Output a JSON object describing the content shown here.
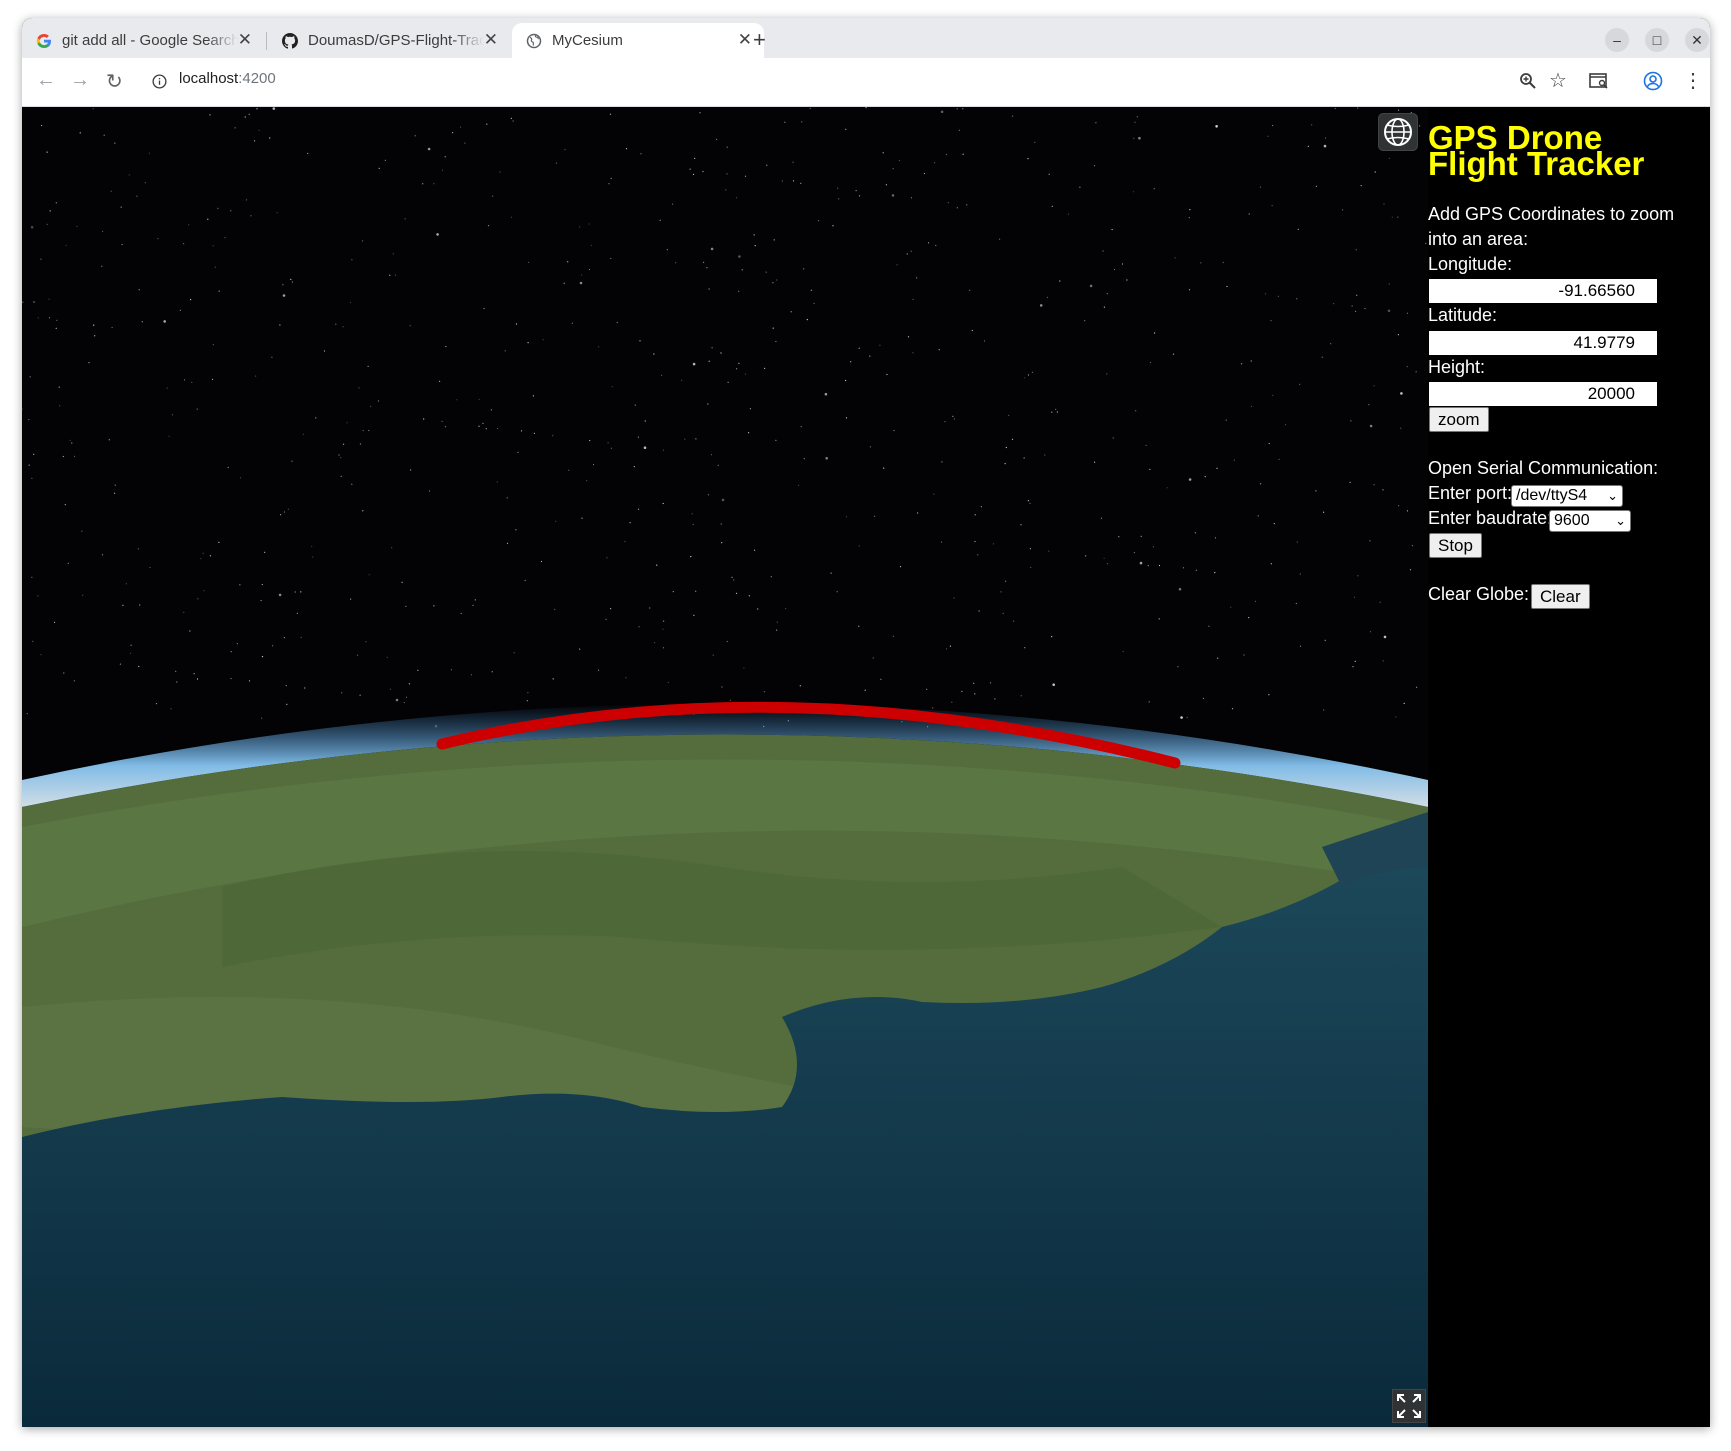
{
  "browser": {
    "tabs": [
      {
        "title": "git add all - Google Search",
        "favicon": "google-icon",
        "active": false
      },
      {
        "title": "DoumasD/GPS-Flight-Tracker",
        "favicon": "github-icon",
        "active": false
      },
      {
        "title": "MyCesium",
        "favicon": "globe-icon",
        "active": true
      }
    ],
    "new_tab_glyph": "+",
    "url_host": "localhost",
    "url_port": ":4200",
    "window_controls": {
      "minimize": "–",
      "maximize": "□",
      "close": "✕"
    }
  },
  "viewer": {
    "globe_button_icon": "globe-icon",
    "fullscreen_button_icon": "fullscreen-icon",
    "flight_path_color": "#cc0000"
  },
  "panel": {
    "title": "GPS Drone Flight Tracker",
    "zoom_intro": "Add GPS Coordinates to zoom into an area:",
    "longitude_label": "Longitude:",
    "longitude_value": "-91.66560",
    "latitude_label": "Latitude:",
    "latitude_value": "41.9779",
    "height_label": "Height:",
    "height_value": "20000",
    "zoom_button": "zoom",
    "serial_heading": "Open Serial Communication:",
    "port_label": "Enter port:",
    "port_value": "/dev/ttyS4",
    "baud_label": "Enter baudrate:",
    "baud_value": "9600",
    "stop_button": "Stop",
    "clear_label": "Clear Globe:",
    "clear_button": "Clear",
    "title_color": "#ffff00"
  }
}
